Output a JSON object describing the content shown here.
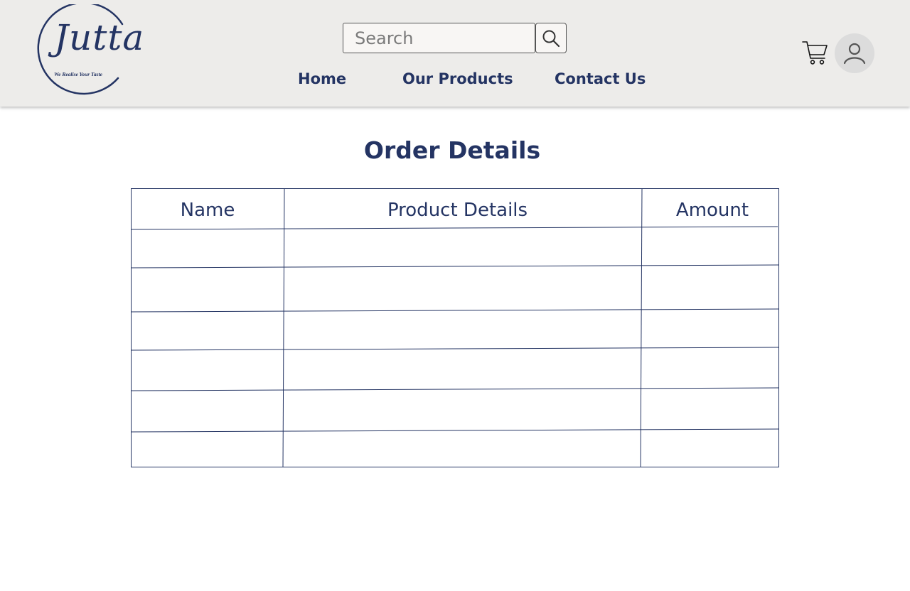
{
  "logo": {
    "brand": "Jutta",
    "tagline": "We Realise Your Taste",
    "icon": "logo-circle"
  },
  "search": {
    "placeholder": "Search",
    "value": "",
    "button_icon": "search-icon"
  },
  "nav": {
    "items": [
      {
        "label": "Home"
      },
      {
        "label": "Our Products"
      },
      {
        "label": "Contact Us"
      }
    ]
  },
  "actions": {
    "cart_icon": "cart-icon",
    "avatar_icon": "user-icon"
  },
  "page": {
    "title": "Order Details"
  },
  "table": {
    "columns": [
      "Name",
      "Product Details",
      "Amount"
    ],
    "rows": [
      [
        "",
        "",
        ""
      ],
      [
        "",
        "",
        ""
      ],
      [
        "",
        "",
        ""
      ],
      [
        "",
        "",
        ""
      ],
      [
        "",
        "",
        ""
      ],
      [
        "",
        "",
        ""
      ]
    ]
  },
  "colors": {
    "brand": "#243463",
    "header_bg": "#edecea",
    "avatar_bg": "#dcdcdc"
  }
}
